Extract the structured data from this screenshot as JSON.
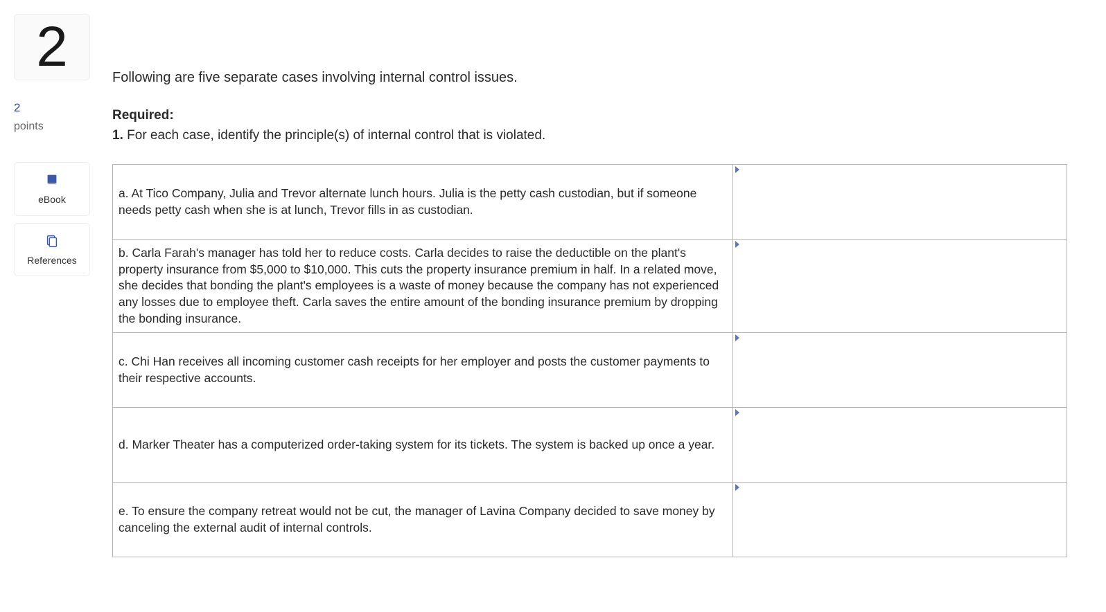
{
  "sidebar": {
    "question_display_number": "2",
    "points_value": "2",
    "points_label": "points",
    "ebook_label": "eBook",
    "references_label": "References"
  },
  "content": {
    "intro": "Following are five separate cases involving internal control issues.",
    "required_heading": "Required:",
    "required_number": "1.",
    "required_text": "For each case, identify the principle(s) of internal control that is violated."
  },
  "cases": [
    {
      "text": "a. At Tico Company, Julia and Trevor alternate lunch hours. Julia is the petty cash custodian, but if someone needs petty cash when she is at lunch, Trevor fills in as custodian.",
      "answer": ""
    },
    {
      "text": "b. Carla Farah's manager has told her to reduce costs. Carla decides to raise the deductible on the plant's property insurance from $5,000 to $10,000. This cuts the property insurance premium in half. In a related move, she decides that bonding the plant's employees is a waste of money because the company has not experienced any losses due to employee theft. Carla saves the entire amount of the bonding insurance premium by dropping the bonding insurance.",
      "answer": ""
    },
    {
      "text": "c. Chi Han receives all incoming customer cash receipts for her employer and posts the customer payments to their respective accounts.",
      "answer": ""
    },
    {
      "text": "d. Marker Theater has a computerized order-taking system for its tickets. The system is backed up once a year.",
      "answer": ""
    },
    {
      "text": "e. To ensure the company retreat would not be cut, the manager of Lavina Company decided to save money by canceling the external audit of internal controls.",
      "answer": ""
    }
  ]
}
